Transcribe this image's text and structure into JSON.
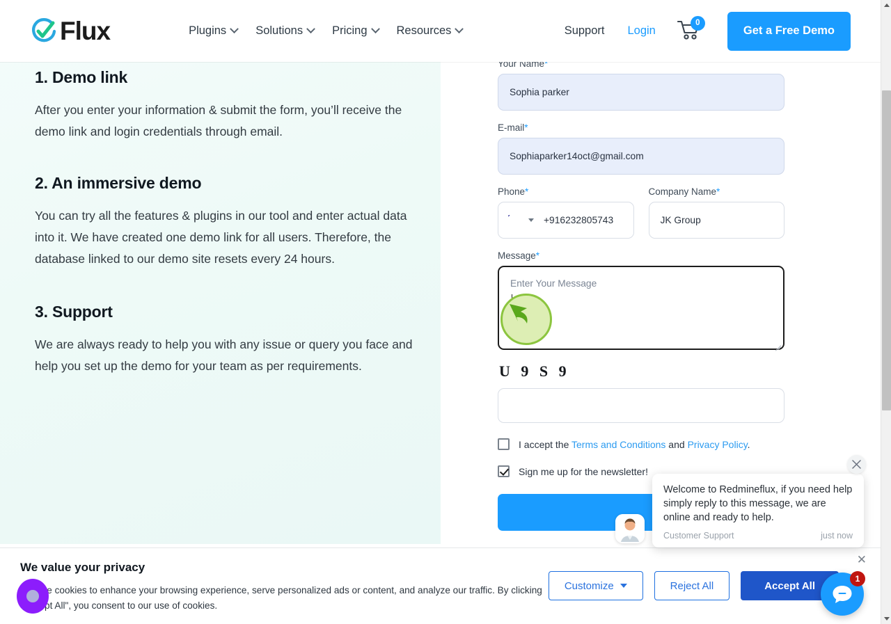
{
  "header": {
    "logo_text": "Flux",
    "logo_icon": "flux-check-circle-logo",
    "nav": [
      {
        "label": "Plugins",
        "icon": "chevron-down-icon"
      },
      {
        "label": "Solutions",
        "icon": "chevron-down-icon"
      },
      {
        "label": "Pricing",
        "icon": "chevron-down-icon"
      },
      {
        "label": "Resources",
        "icon": "chevron-down-icon"
      }
    ],
    "support_label": "Support",
    "login_label": "Login",
    "cart_icon": "shopping-cart-icon",
    "cart_count": "0",
    "demo_button_label": "Get a Free Demo",
    "accent_color": "#1a9cff"
  },
  "left": {
    "sections": [
      {
        "heading": "1. Demo link",
        "body": "After you enter your information & submit the form, you’ll receive the demo link and login credentials through email."
      },
      {
        "heading": "2. An immersive demo",
        "body": "You can try all the features & plugins in our tool and enter actual data into it. We have created one demo link for all users. Therefore, the database linked to our demo site resets every 24 hours."
      },
      {
        "heading": "3. Support",
        "body": "We are always ready to help you with any issue or query you face and help you set up the demo for your team as per requirements."
      }
    ]
  },
  "form": {
    "name": {
      "label": "Your Name",
      "required": "*",
      "value": "Sophia parker"
    },
    "email": {
      "label": "E-mail",
      "required": "*",
      "value": "Sophiaparker14oct@gmail.com"
    },
    "phone": {
      "label": "Phone",
      "required": "*",
      "value": "+916232805743",
      "flag_icon": "india-flag-icon"
    },
    "company": {
      "label": "Company Name",
      "required": "*",
      "value": "JK Group"
    },
    "message": {
      "label": "Message",
      "required": "*",
      "placeholder": "Enter Your Message",
      "value": ""
    },
    "captcha": {
      "text": "U 9 S 9",
      "input_value": ""
    },
    "terms": {
      "prefix": "I accept the ",
      "terms_link": "Terms and Conditions",
      "middle": " and ",
      "privacy_link": "Privacy Policy",
      "suffix": ".",
      "checked": false
    },
    "newsletter": {
      "label": "Sign me up for the newsletter!",
      "checked": true
    },
    "submit_label": ""
  },
  "chat": {
    "close_icon": "close-icon",
    "message": "Welcome to Redmineflux, if you need help simply reply to this message, we are online and ready to help.",
    "sender": "Customer Support",
    "time": "just now",
    "avatar_icon": "support-agent-avatar",
    "bubble_icon": "chat-bubble-icon",
    "unread_count": "1",
    "bubble_color": "#1a9cff",
    "badge_color": "#c0150f"
  },
  "cookie": {
    "title": "We value your privacy",
    "text": "We use cookies to enhance your browsing experience, serve personalized ads or content, and analyze our traffic. By clicking \"Accept All\", you consent to our use of cookies.",
    "customize_label": "Customize",
    "reject_label": "Reject All",
    "accept_label": "Accept All",
    "close_icon": "close-icon"
  },
  "overlays": {
    "green_cursor_icon": "mouse-cursor-arrow-highlight",
    "purple_cursor_icon": "cursor-dot-highlight"
  },
  "scrollbar": {
    "up_icon": "scroll-up-arrow",
    "down_icon": "scroll-down-arrow"
  }
}
